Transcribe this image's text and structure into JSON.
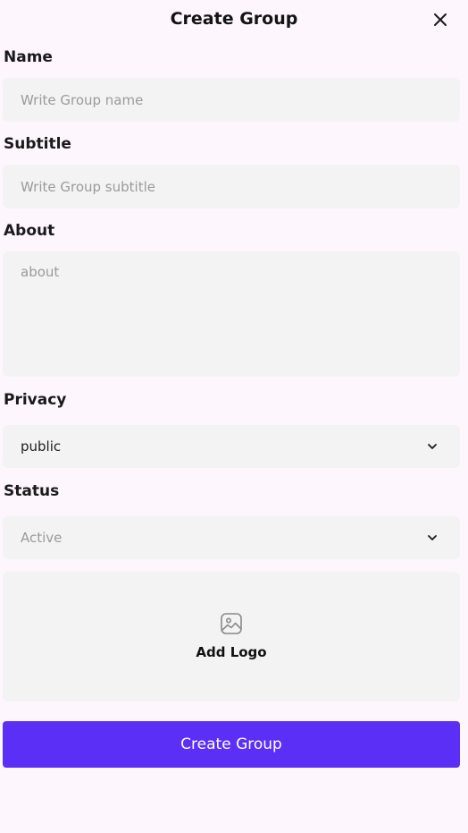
{
  "colors": {
    "background": "#fdf6fd",
    "field_background": "#f3f3f3",
    "primary": "#5b2ff5"
  },
  "header": {
    "title": "Create Group",
    "close_icon": "close-icon"
  },
  "form": {
    "name": {
      "label": "Name",
      "placeholder": "Write Group name",
      "value": ""
    },
    "subtitle": {
      "label": "Subtitle",
      "placeholder": "Write Group subtitle",
      "value": ""
    },
    "about": {
      "label": "About",
      "placeholder": "about",
      "value": ""
    },
    "privacy": {
      "label": "Privacy",
      "selected": "public",
      "icon": "chevron-down-icon"
    },
    "status": {
      "label": "Status",
      "selected": "Active",
      "icon": "chevron-down-icon"
    },
    "logo_upload": {
      "label": "Add Logo",
      "icon": "image-icon"
    },
    "submit_label": "Create Group"
  }
}
